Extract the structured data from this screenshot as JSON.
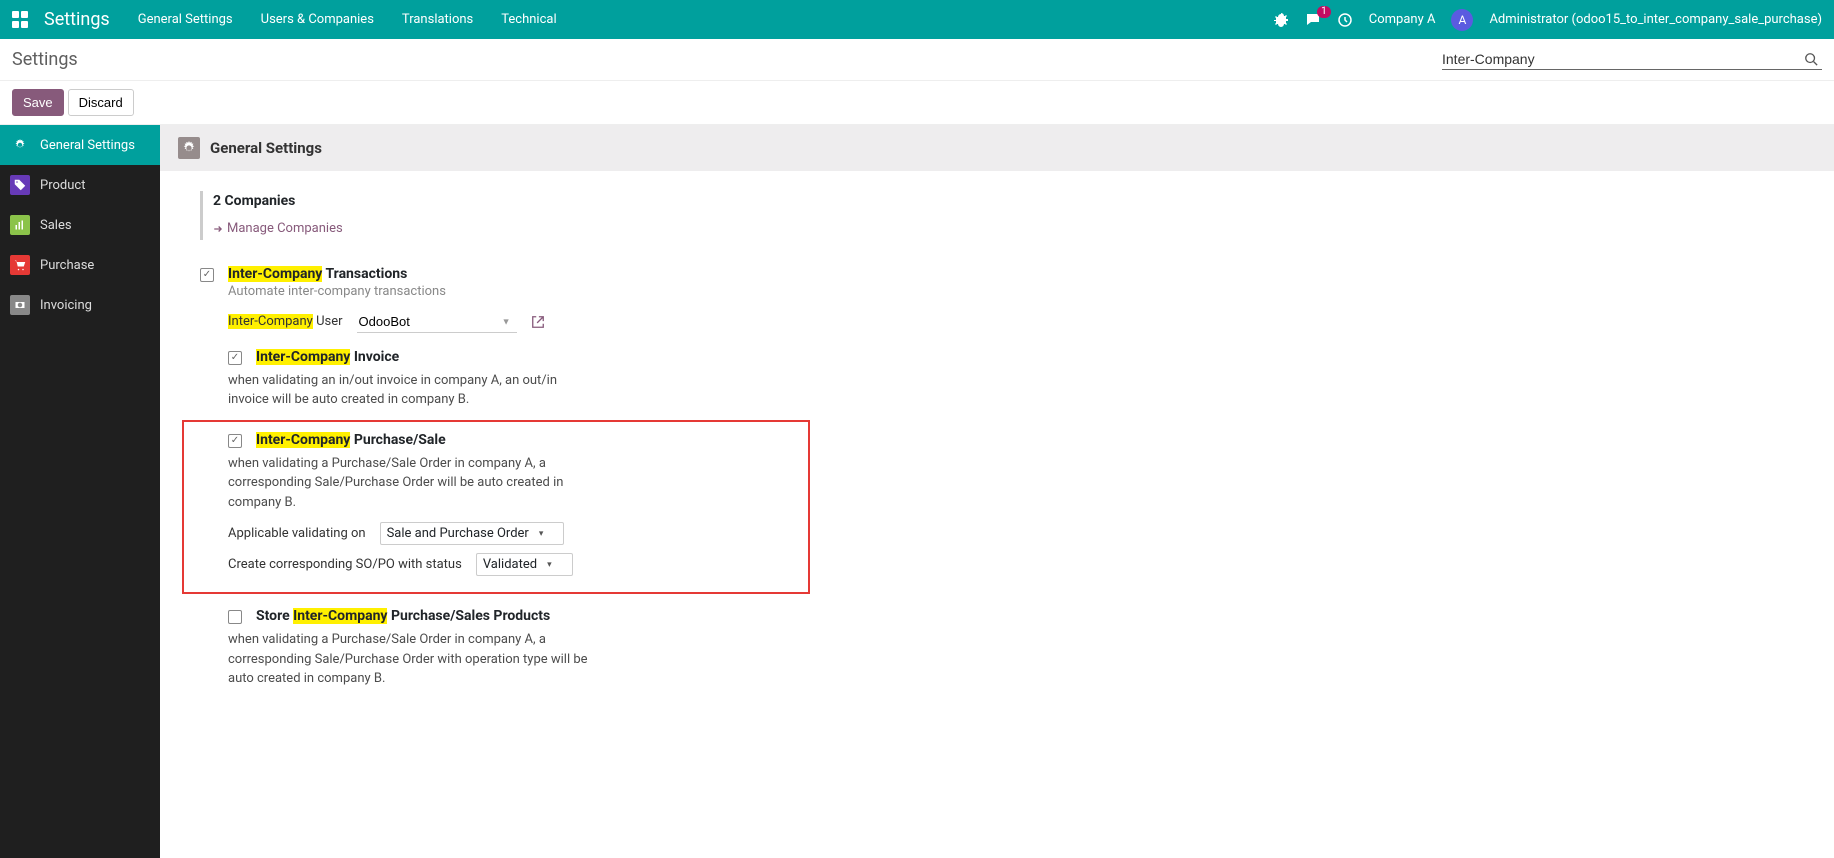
{
  "navbar": {
    "title": "Settings",
    "menu": [
      "General Settings",
      "Users & Companies",
      "Translations",
      "Technical"
    ],
    "msg_count": "1",
    "company": "Company A",
    "avatar_letter": "A",
    "user": "Administrator (odoo15_to_inter_company_sale_purchase)"
  },
  "breadcrumb": {
    "title": "Settings"
  },
  "search": {
    "value": "Inter-Company"
  },
  "buttons": {
    "save": "Save",
    "discard": "Discard"
  },
  "sidebar": {
    "items": [
      {
        "label": "General Settings"
      },
      {
        "label": "Product"
      },
      {
        "label": "Sales"
      },
      {
        "label": "Purchase"
      },
      {
        "label": "Invoicing"
      }
    ]
  },
  "section": {
    "title": "General Settings"
  },
  "companies": {
    "count_label": "2 Companies",
    "manage_label": "Manage Companies"
  },
  "intercompany": {
    "title_hl": "Inter-Company",
    "title_rest": " Transactions",
    "desc": "Automate inter-company transactions",
    "user_label_hl": "Inter-Company",
    "user_label_rest": " User",
    "user_value": "OdooBot"
  },
  "invoice": {
    "title_hl": "Inter-Company",
    "title_rest": " Invoice",
    "desc": "when validating an in/out invoice in company A, an out/in invoice will be auto created in company B."
  },
  "purchasesale": {
    "title_hl": "Inter-Company",
    "title_rest": " Purchase/Sale",
    "desc": "when validating a Purchase/Sale Order in company A, a corresponding Sale/Purchase Order will be auto created in company B.",
    "applicable_label": "Applicable validating on",
    "applicable_value": "Sale and Purchase Order",
    "status_label": "Create corresponding SO/PO with status",
    "status_value": "Validated"
  },
  "store": {
    "title_pre": "Store ",
    "title_hl": "Inter-Company",
    "title_post": " Purchase/Sales Products",
    "desc": "when validating a Purchase/Sale Order in company A, a corresponding Sale/Purchase Order with operation type will be auto created in company B."
  }
}
